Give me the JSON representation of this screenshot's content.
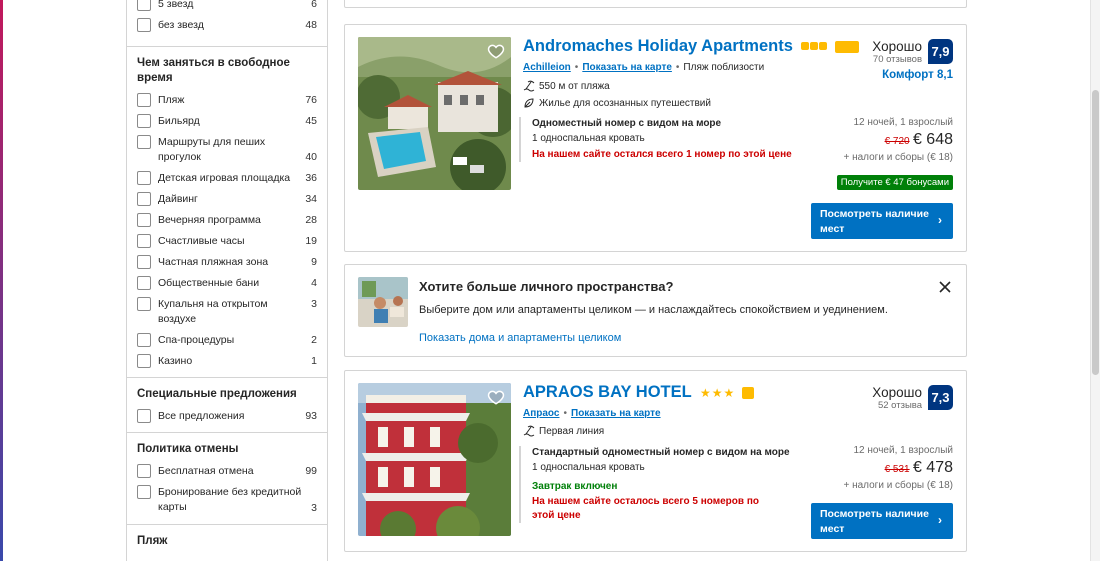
{
  "sidebar": {
    "stars_partial": [
      {
        "label": "5 звезд",
        "count": "6"
      },
      {
        "label": "без звезд",
        "count": "48"
      }
    ],
    "leisure": {
      "title": "Чем заняться в свободное время",
      "items": [
        {
          "label": "Пляж",
          "count": "76"
        },
        {
          "label": "Бильярд",
          "count": "45"
        },
        {
          "label": "Маршруты для пеших прогулок",
          "count": "40"
        },
        {
          "label": "Детская игровая площадка",
          "count": "36"
        },
        {
          "label": "Дайвинг",
          "count": "34"
        },
        {
          "label": "Вечерняя программа",
          "count": "28"
        },
        {
          "label": "Счастливые часы",
          "count": "19"
        },
        {
          "label": "Частная пляжная зона",
          "count": "9"
        },
        {
          "label": "Общественные бани",
          "count": "4"
        },
        {
          "label": "Купальня на открытом воздухе",
          "count": "3"
        },
        {
          "label": "Спа-процедуры",
          "count": "2"
        },
        {
          "label": "Казино",
          "count": "1"
        }
      ]
    },
    "deals": {
      "title": "Специальные предложения",
      "items": [
        {
          "label": "Все предложения",
          "count": "93"
        }
      ]
    },
    "cancel": {
      "title": "Политика отмены",
      "items": [
        {
          "label": "Бесплатная отмена",
          "count": "99"
        },
        {
          "label": "Бронирование без кредитной карты",
          "count": "3"
        }
      ]
    },
    "beach": {
      "title": "Пляж"
    }
  },
  "hotels": [
    {
      "name": "Andromaches Holiday Apartments",
      "location": "Achilleion",
      "map_link": "Показать на карте",
      "extra": "Пляж поблизости",
      "feature1": "550 м от пляжа",
      "feature2": "Жилье для осознанных путешествий",
      "room_name": "Одноместный номер с видом на море",
      "room_bed": "1 односпальная кровать",
      "room_warn": "На нашем сайте остался всего 1 номер по этой цене",
      "score_word": "Хорошо",
      "reviews": "70 отзывов",
      "score": "7,9",
      "comfort": "Комфорт 8,1",
      "nights": "12 ночей, 1 взрослый",
      "old_price": "€ 720",
      "new_price": "€ 648",
      "tax": "+ налоги и сборы (€ 18)",
      "bonus": "Получите € 47 бонусами",
      "cta": "Посмотреть наличие мест"
    },
    {
      "name": "APRAOS BAY HOTEL",
      "location": "Апраос",
      "map_link": "Показать на карте",
      "feature1": "Первая линия",
      "room_name": "Стандартный одноместный номер с видом на море",
      "room_bed": "1 односпальная кровать",
      "room_green": "Завтрак включен",
      "room_warn": "На нашем сайте осталось всего 5 номеров по этой цене",
      "score_word": "Хорошо",
      "reviews": "52 отзыва",
      "score": "7,3",
      "nights": "12 ночей, 1 взрослый",
      "old_price": "€ 531",
      "new_price": "€ 478",
      "tax": "+ налоги и сборы (€ 18)",
      "cta": "Посмотреть наличие мест"
    }
  ],
  "promo": {
    "title": "Хотите больше личного пространства?",
    "text": "Выберите дом или апартаменты целиком — и наслаждайтесь спокойствием и уединением.",
    "link": "Показать дома и апартаменты целиком"
  },
  "colors": {
    "brand": "#003580",
    "link": "#0071c2",
    "warn": "#cc0000",
    "green": "#008009",
    "star": "#febb02"
  }
}
